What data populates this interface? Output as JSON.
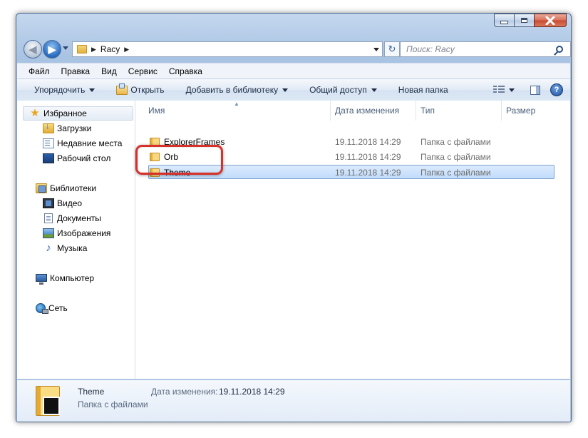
{
  "address": {
    "path": "Racy",
    "search_placeholder": "Поиск: Racy"
  },
  "menu": [
    "Файл",
    "Правка",
    "Вид",
    "Сервис",
    "Справка"
  ],
  "toolbar": {
    "organize": "Упорядочить",
    "open": "Открыть",
    "add_to_library": "Добавить в библиотеку",
    "share": "Общий доступ",
    "new_folder": "Новая папка",
    "help": "?"
  },
  "nav": {
    "favorites": "Избранное",
    "downloads": "Загрузки",
    "recent": "Недавние места",
    "desktop": "Рабочий стол",
    "libraries": "Библиотеки",
    "video": "Видео",
    "documents": "Документы",
    "images": "Изображения",
    "music": "Музыка",
    "computer": "Компьютер",
    "network": "Сеть"
  },
  "columns": {
    "name": "Имя",
    "date": "Дата изменения",
    "type": "Тип",
    "size": "Размер"
  },
  "files": [
    {
      "name": "ExplorerFrames",
      "date": "19.11.2018 14:29",
      "type": "Папка с файлами"
    },
    {
      "name": "Orb",
      "date": "19.11.2018 14:29",
      "type": "Папка с файлами"
    },
    {
      "name": "Theme",
      "date": "19.11.2018 14:29",
      "type": "Папка с файлами"
    }
  ],
  "details": {
    "name": "Theme",
    "type": "Папка с файлами",
    "date_label": "Дата изменения:",
    "date_value": "19.11.2018 14:29"
  }
}
